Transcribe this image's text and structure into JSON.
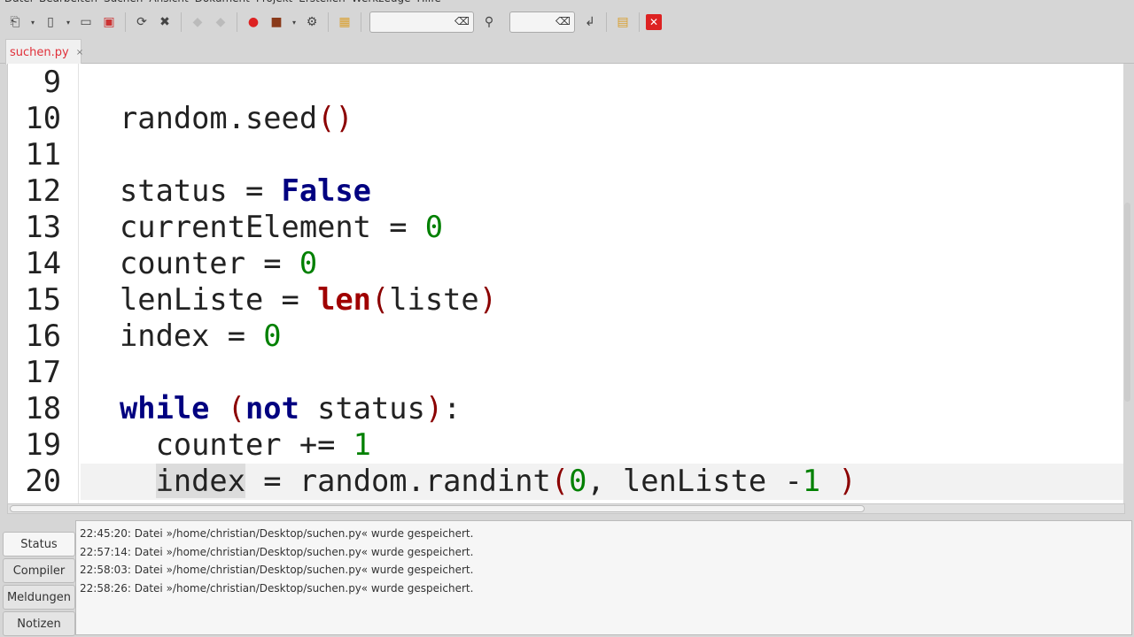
{
  "menu": [
    "Datei",
    "Bearbeiten",
    "Suchen",
    "Ansicht",
    "Dokument",
    "Projekt",
    "Erstellen",
    "Werkzeuge",
    "Hilfe"
  ],
  "toolbar": {
    "search_value": "",
    "goto_value": ""
  },
  "tab": {
    "name": "suchen.py",
    "close": "×"
  },
  "code": [
    {
      "n": "9",
      "t": []
    },
    {
      "n": "10",
      "t": [
        [
          "",
          "random.seed"
        ],
        [
          "p",
          "()"
        ]
      ]
    },
    {
      "n": "11",
      "t": []
    },
    {
      "n": "12",
      "t": [
        [
          "",
          "status = "
        ],
        [
          "k",
          "False"
        ]
      ]
    },
    {
      "n": "13",
      "t": [
        [
          "",
          "currentElement = "
        ],
        [
          "n",
          "0"
        ]
      ]
    },
    {
      "n": "14",
      "t": [
        [
          "",
          "counter = "
        ],
        [
          "n",
          "0"
        ]
      ]
    },
    {
      "n": "15",
      "t": [
        [
          "",
          "lenListe = "
        ],
        [
          "b",
          "len"
        ],
        [
          "p",
          "("
        ],
        [
          "",
          "liste"
        ],
        [
          "p",
          ")"
        ]
      ]
    },
    {
      "n": "16",
      "t": [
        [
          "",
          "index = "
        ],
        [
          "n",
          "0"
        ]
      ]
    },
    {
      "n": "17",
      "t": []
    },
    {
      "n": "18",
      "t": [
        [
          "k",
          "while"
        ],
        [
          "",
          " "
        ],
        [
          "p",
          "("
        ],
        [
          "k",
          "not"
        ],
        [
          "",
          " status"
        ],
        [
          "p",
          ")"
        ],
        [
          "",
          ":"
        ]
      ]
    },
    {
      "n": "19",
      "t": [
        [
          "",
          "  counter += "
        ],
        [
          "n",
          "1"
        ]
      ]
    },
    {
      "n": "20",
      "t": [
        [
          "",
          "  "
        ],
        [
          "hl",
          "index"
        ],
        [
          "",
          " = random.randint"
        ],
        [
          "p",
          "("
        ],
        [
          "n",
          "0"
        ],
        [
          "",
          ", lenListe -"
        ],
        [
          "n",
          "1"
        ],
        [
          "",
          " "
        ],
        [
          "p",
          ")"
        ]
      ]
    }
  ],
  "bottom": {
    "tabs": [
      "Status",
      "Compiler",
      "Meldungen",
      "Notizen"
    ],
    "log": [
      "22:45:20: Datei »/home/christian/Desktop/suchen.py« wurde gespeichert.",
      "22:57:14: Datei »/home/christian/Desktop/suchen.py« wurde gespeichert.",
      "22:58:03: Datei »/home/christian/Desktop/suchen.py« wurde gespeichert.",
      "22:58:26: Datei »/home/christian/Desktop/suchen.py« wurde gespeichert."
    ]
  }
}
